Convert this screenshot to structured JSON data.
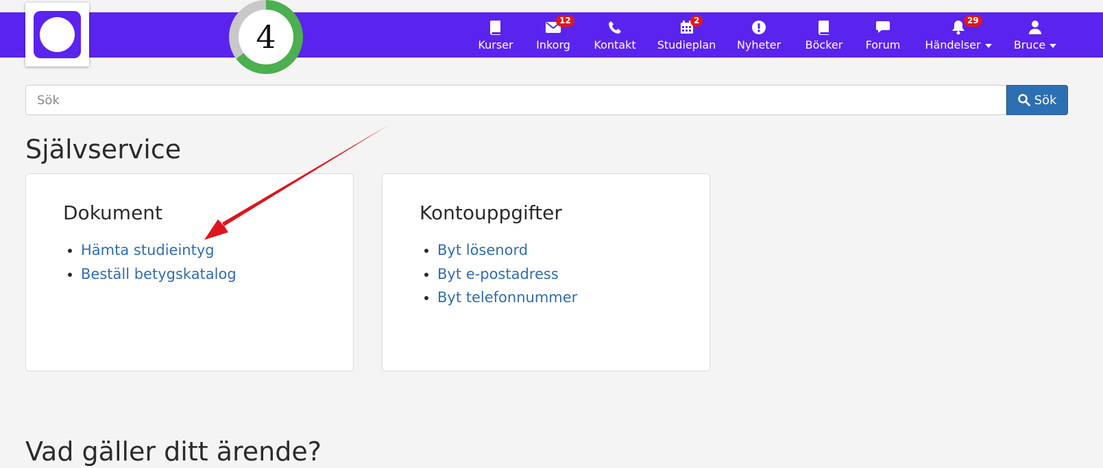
{
  "header": {
    "progress_value": "4",
    "progress_fraction": 0.65,
    "progress_color": "#4caf50",
    "nav_color": "#5b23ee",
    "nav_items": [
      {
        "label": "Kurser",
        "icon": "book-icon"
      },
      {
        "label": "Inkorg",
        "icon": "envelope-icon",
        "badge": "12"
      },
      {
        "label": "Kontakt",
        "icon": "phone-icon"
      },
      {
        "label": "Studieplan",
        "icon": "calendar-icon",
        "badge": "2"
      },
      {
        "label": "Nyheter",
        "icon": "exclamation-circle-icon"
      },
      {
        "label": "Böcker",
        "icon": "book-icon"
      },
      {
        "label": "Forum",
        "icon": "speech-bubble-icon"
      },
      {
        "label": "Händelser",
        "icon": "bell-icon",
        "badge": "29",
        "dropdown": true
      },
      {
        "label": "Bruce",
        "icon": "user-icon",
        "dropdown": true
      }
    ]
  },
  "search": {
    "placeholder": "Sök",
    "button_label": "Sök"
  },
  "self_service": {
    "title": "Självservice",
    "cards": [
      {
        "title": "Dokument",
        "links": [
          "Hämta studieintyg",
          "Beställ betygskatalog"
        ]
      },
      {
        "title": "Kontouppgifter",
        "links": [
          "Byt lösenord",
          "Byt e-postadress",
          "Byt telefonnummer"
        ]
      }
    ]
  },
  "case_section": {
    "title": "Vad gäller ditt ärende?"
  },
  "annotation": {
    "arrow_color": "#e0141b"
  }
}
